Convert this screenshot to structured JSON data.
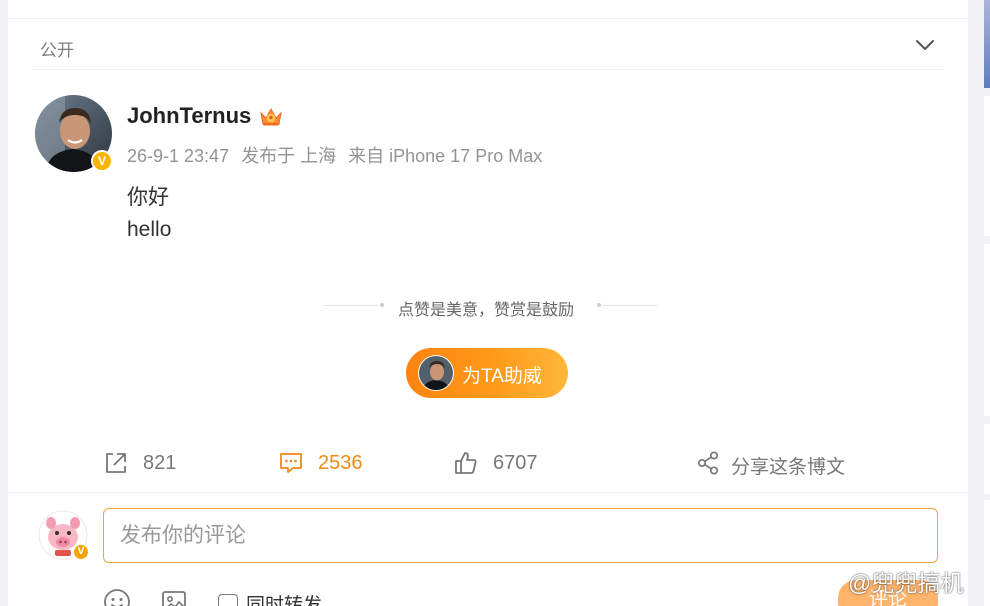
{
  "privacy": {
    "label": "公开"
  },
  "post": {
    "author": "JohnTernus",
    "time": "26-9-1 23:47",
    "location": "发布于 上海",
    "source": "来自 iPhone 17 Pro Max",
    "lines": [
      "你好",
      "hello"
    ],
    "verify_badge": "V"
  },
  "reward": {
    "text": "点赞是美意，赞赏是鼓励",
    "button_label": "为TA助威"
  },
  "actions": {
    "repost_count": "821",
    "comment_count": "2536",
    "like_count": "6707",
    "share_label": "分享这条博文"
  },
  "composer": {
    "placeholder": "发布你的评论",
    "repost_label": "同时转发",
    "submit_label": "评论",
    "badge": "V"
  },
  "watermark": {
    "text": "@兜兜搞机"
  },
  "colors": {
    "accent": "#f08a16",
    "button_gradient_start": "#fd8410",
    "button_gradient_end": "#ffb73a",
    "verify": "#f8b400"
  }
}
